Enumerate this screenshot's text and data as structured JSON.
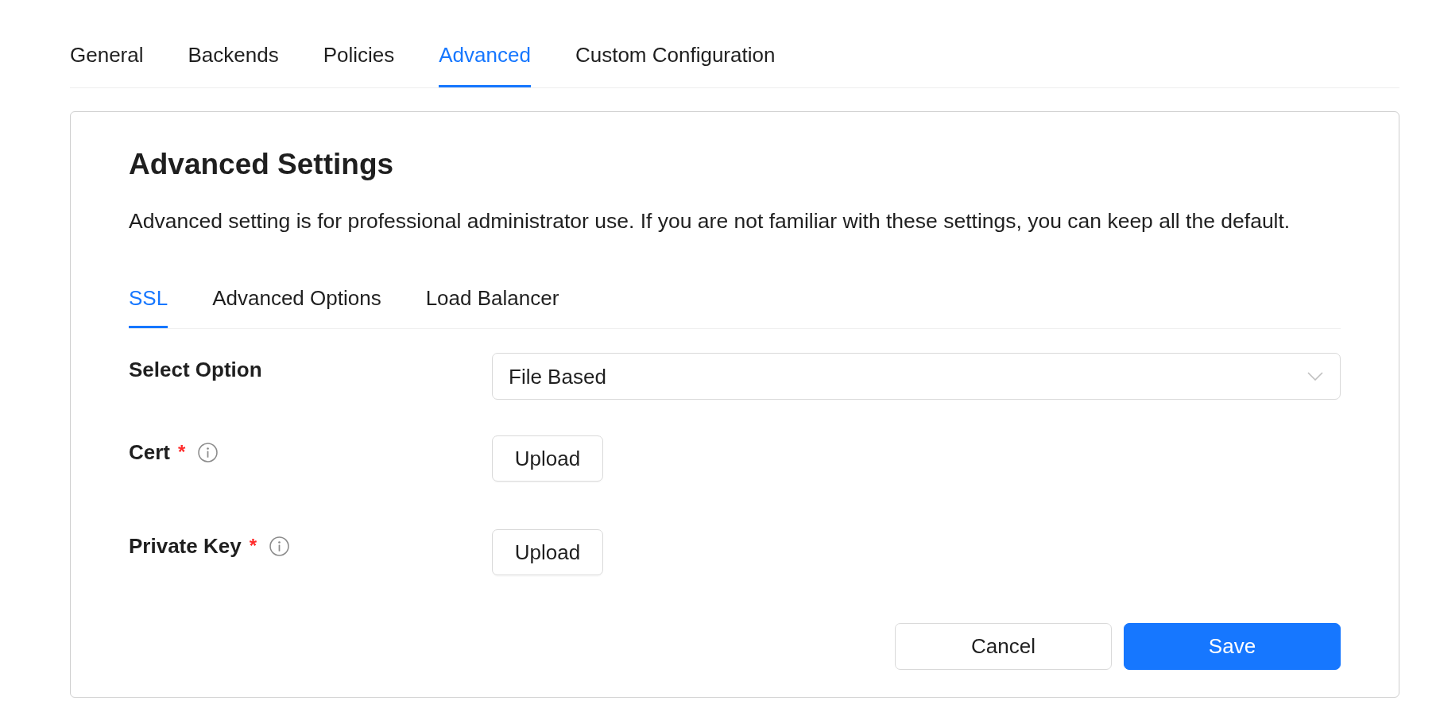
{
  "tabs": [
    {
      "label": "General",
      "selected": false
    },
    {
      "label": "Backends",
      "selected": false
    },
    {
      "label": "Policies",
      "selected": false
    },
    {
      "label": "Advanced",
      "selected": true
    },
    {
      "label": "Custom Configuration",
      "selected": false
    }
  ],
  "panel": {
    "title": "Advanced Settings",
    "description": "Advanced setting is for professional administrator use. If you are not familiar with these settings, you can keep all the default.",
    "tabs": [
      {
        "label": "SSL",
        "selected": true
      },
      {
        "label": "Advanced Options",
        "selected": false
      },
      {
        "label": "Load Balancer",
        "selected": false
      }
    ],
    "fields": [
      {
        "kind": "select",
        "label": "Select Option",
        "info": false,
        "value": "File Based"
      },
      {
        "kind": "upload",
        "label": "Cert",
        "required_mark": "*",
        "info": true,
        "button": "Upload"
      },
      {
        "kind": "upload",
        "label": "Private Key",
        "required_mark": "*",
        "info": true,
        "button": "Upload"
      }
    ],
    "actions": [
      {
        "label": "Cancel",
        "primary": false
      },
      {
        "label": "Save",
        "primary": true
      }
    ]
  }
}
